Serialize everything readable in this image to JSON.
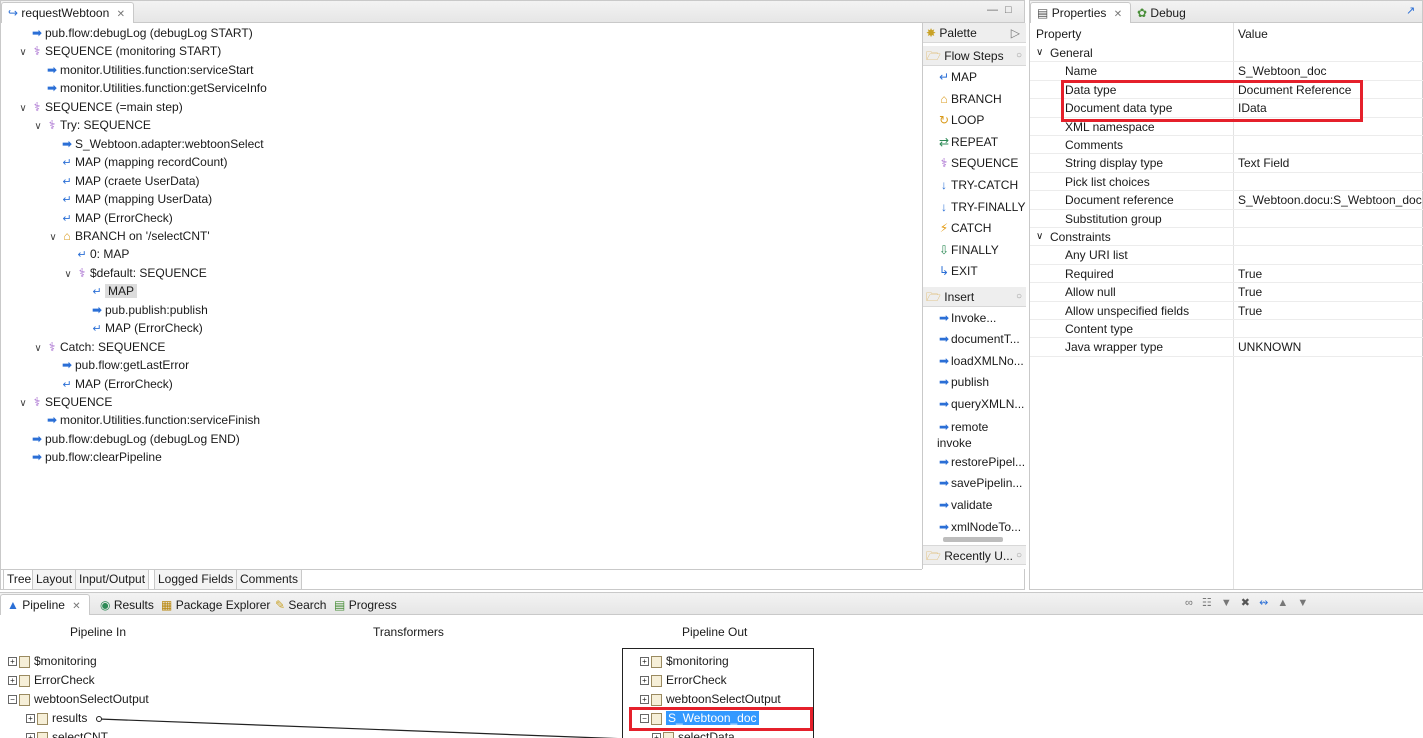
{
  "editor": {
    "tab_title": "requestWebtoon",
    "tree": [
      {
        "indent": 0,
        "twisty": "",
        "icon": "invoke",
        "label": "pub.flow:debugLog (debugLog START)"
      },
      {
        "indent": 0,
        "twisty": "v",
        "icon": "sequence",
        "label": "SEQUENCE (monitoring START)"
      },
      {
        "indent": 1,
        "twisty": "",
        "icon": "invoke",
        "label": "monitor.Utilities.function:serviceStart"
      },
      {
        "indent": 1,
        "twisty": "",
        "icon": "invoke",
        "label": "monitor.Utilities.function:getServiceInfo"
      },
      {
        "indent": 0,
        "twisty": "v",
        "icon": "sequence",
        "label": "SEQUENCE (=main step)"
      },
      {
        "indent": 1,
        "twisty": "v",
        "icon": "sequence",
        "label": "Try: SEQUENCE"
      },
      {
        "indent": 2,
        "twisty": "",
        "icon": "invoke",
        "label": "S_Webtoon.adapter:webtoonSelect"
      },
      {
        "indent": 2,
        "twisty": "",
        "icon": "map",
        "label": "MAP (mapping recordCount)"
      },
      {
        "indent": 2,
        "twisty": "",
        "icon": "map",
        "label": "MAP (craete UserData)"
      },
      {
        "indent": 2,
        "twisty": "",
        "icon": "map",
        "label": "MAP (mapping UserData)"
      },
      {
        "indent": 2,
        "twisty": "",
        "icon": "map",
        "label": "MAP (ErrorCheck)"
      },
      {
        "indent": 2,
        "twisty": "v",
        "icon": "branch",
        "label": "BRANCH on '/selectCNT'"
      },
      {
        "indent": 3,
        "twisty": "",
        "icon": "map",
        "label": "0: MAP"
      },
      {
        "indent": 3,
        "twisty": "v",
        "icon": "sequence",
        "label": "$default: SEQUENCE"
      },
      {
        "indent": 4,
        "twisty": "",
        "icon": "map",
        "label": "MAP",
        "selected": true
      },
      {
        "indent": 4,
        "twisty": "",
        "icon": "invoke",
        "label": "pub.publish:publish"
      },
      {
        "indent": 4,
        "twisty": "",
        "icon": "map",
        "label": "MAP (ErrorCheck)"
      },
      {
        "indent": 1,
        "twisty": "v",
        "icon": "sequence",
        "label": "Catch: SEQUENCE"
      },
      {
        "indent": 2,
        "twisty": "",
        "icon": "invoke",
        "label": "pub.flow:getLastError"
      },
      {
        "indent": 2,
        "twisty": "",
        "icon": "map",
        "label": "MAP (ErrorCheck)"
      },
      {
        "indent": 0,
        "twisty": "v",
        "icon": "sequence",
        "label": "SEQUENCE"
      },
      {
        "indent": 1,
        "twisty": "",
        "icon": "invoke",
        "label": "monitor.Utilities.function:serviceFinish"
      },
      {
        "indent": 0,
        "twisty": "",
        "icon": "invoke",
        "label": "pub.flow:debugLog (debugLog END)"
      },
      {
        "indent": 0,
        "twisty": "",
        "icon": "invoke",
        "label": "pub.flow:clearPipeline"
      }
    ],
    "bottom_tabs": [
      "Tree",
      "Layout",
      "Input/Output",
      "Logged Fields",
      "Comments"
    ]
  },
  "palette": {
    "title": "Palette",
    "flow_steps_label": "Flow Steps",
    "flow_steps": [
      "MAP",
      "BRANCH",
      "LOOP",
      "REPEAT",
      "SEQUENCE",
      "TRY-CATCH",
      "TRY-FINALLY",
      "CATCH",
      "FINALLY",
      "EXIT"
    ],
    "insert_label": "Insert",
    "insert_items": [
      "Invoke...",
      "documentT...",
      "loadXMLNo...",
      "publish",
      "queryXMLN...",
      "remote invoke",
      "restorePipel...",
      "savePipelin...",
      "validate",
      "xmlNodeTo..."
    ],
    "recently_label": "Recently U..."
  },
  "properties": {
    "tab_label": "Properties",
    "debug_tab_label": "Debug",
    "col_property": "Property",
    "col_value": "Value",
    "rows": [
      {
        "type": "group",
        "label": "General"
      },
      {
        "key": "Name",
        "value": "S_Webtoon_doc"
      },
      {
        "key": "Data type",
        "value": "Document Reference"
      },
      {
        "key": "Document data type",
        "value": "IData"
      },
      {
        "key": "XML namespace",
        "value": ""
      },
      {
        "key": "Comments",
        "value": ""
      },
      {
        "key": "String display type",
        "value": "Text Field"
      },
      {
        "key": "Pick list choices",
        "value": ""
      },
      {
        "key": "Document reference",
        "value": "S_Webtoon.docu:S_Webtoon_doc"
      },
      {
        "key": "Substitution group",
        "value": ""
      },
      {
        "type": "group",
        "label": "Constraints"
      },
      {
        "key": "Any URI list",
        "value": ""
      },
      {
        "key": "Required",
        "value": "True"
      },
      {
        "key": "Allow null",
        "value": "True"
      },
      {
        "key": "Allow unspecified fields",
        "value": "True"
      },
      {
        "key": "Content type",
        "value": ""
      },
      {
        "key": "Java wrapper type",
        "value": "UNKNOWN"
      }
    ]
  },
  "pipeline": {
    "tabs": [
      "Pipeline",
      "Results",
      "Package Explorer",
      "Search",
      "Progress"
    ],
    "col_in": "Pipeline In",
    "col_transformers": "Transformers",
    "col_out": "Pipeline Out",
    "in_items": [
      "$monitoring",
      "ErrorCheck",
      "webtoonSelectOutput",
      "results",
      "selectCNT"
    ],
    "out_items": [
      "$monitoring",
      "ErrorCheck",
      "webtoonSelectOutput",
      "S_Webtoon_doc",
      "selectData"
    ]
  },
  "colors": {
    "highlight": "#e5202b",
    "selection": "#3399ff",
    "accent": "#2b6fd6"
  }
}
